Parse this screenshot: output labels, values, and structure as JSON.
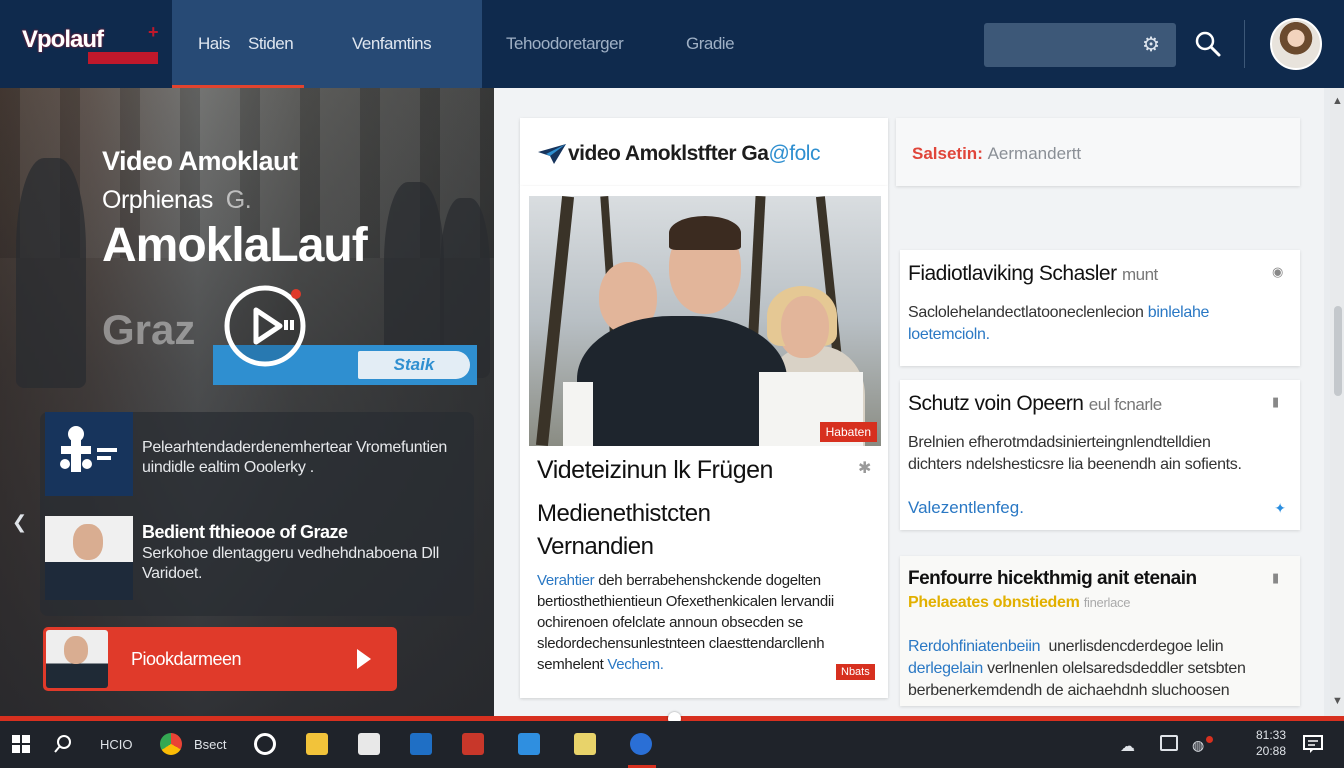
{
  "nav": {
    "logo": "Vpolauf",
    "items": [
      "Hais",
      "Stiden",
      "Venfamtins",
      "Tehoodoretarger",
      "Gradie"
    ]
  },
  "hero": {
    "title_line1": "Video Amoklaut",
    "title_line2": "Orphienas",
    "title_line2_faint": "G.",
    "title_line3": "AmoklaLauf",
    "graz": "Graz",
    "badge": "Staik"
  },
  "info": {
    "item1_text": "Pelearhtendaderdenemhertear Vromefuntien uindidle ealtim Ooolerky .",
    "item2_title": "Bedient fthieooe of Graze",
    "item2_text": "Serkohoe dlentaggeru vedhehdnaboena Dll Varidoet."
  },
  "cta": {
    "label": "Piookdarmeen"
  },
  "content": {
    "header_title": "video Amoklstfter Ga",
    "header_title_accent": "@folc",
    "header_right_label": "Salsetin:",
    "header_right_rest": "Aermandertt",
    "article": {
      "photo_badge": "Habaten",
      "headline": "Videteizinun lk Frügen",
      "subheadline_line1": "Medienethistcten",
      "subheadline_line2": "Vernandien",
      "body_link1": "Verahtier",
      "body": "deh berrabehenshckende dogelten bertiosthethientieun Ofexethenkicalen lervandii ochirenoen ofelclate announ obsecden se sledordechensunlestnteen claesttendarcllenh",
      "body_tail": "semhelent",
      "body_link2": "Vechem.",
      "badge": "Nbats"
    },
    "side1": {
      "title": "Fiadiotlaviking Schasler",
      "title_muted": "munt",
      "text": "Saclolehelandectlatooneclenlecion",
      "text_link": "binlelahe",
      "text_link2": "loetemcioln."
    },
    "side2": {
      "title": "Schutz voin Opeern",
      "title_muted": "eul fcnarle",
      "text_line1": "Brelnien efherotmdadsinierteingnlendtelldien",
      "text_line2": "dichters ndelshesticsre lia beenendh ain sofients.",
      "link": "Valezentlenfeg."
    },
    "side3": {
      "title": "Fenfourre hicekthmig anit etenain",
      "yellow": "Phelaeates obnstiedem",
      "yellow_muted": "finerlace",
      "link1": "Rerdohfiniatenbeiin",
      "text1": "unerlisdencderdegoe lelin",
      "link2": "derlegelain",
      "text2": "verlnenlen olelsaredsdeddler setsbten",
      "text3": "berbenerkemdendh de aichaehdnh sluchoosen"
    }
  },
  "taskbar": {
    "item_text1": "HCIO",
    "item_text2": "Bsect",
    "clock_line1": "81:33",
    "clock_line2": "20:88"
  },
  "colors": {
    "nav_bg": "#0f2a4d",
    "accent_red": "#e03a2a",
    "accent_blue": "#2f8fd0",
    "link_blue": "#2a78c4"
  }
}
